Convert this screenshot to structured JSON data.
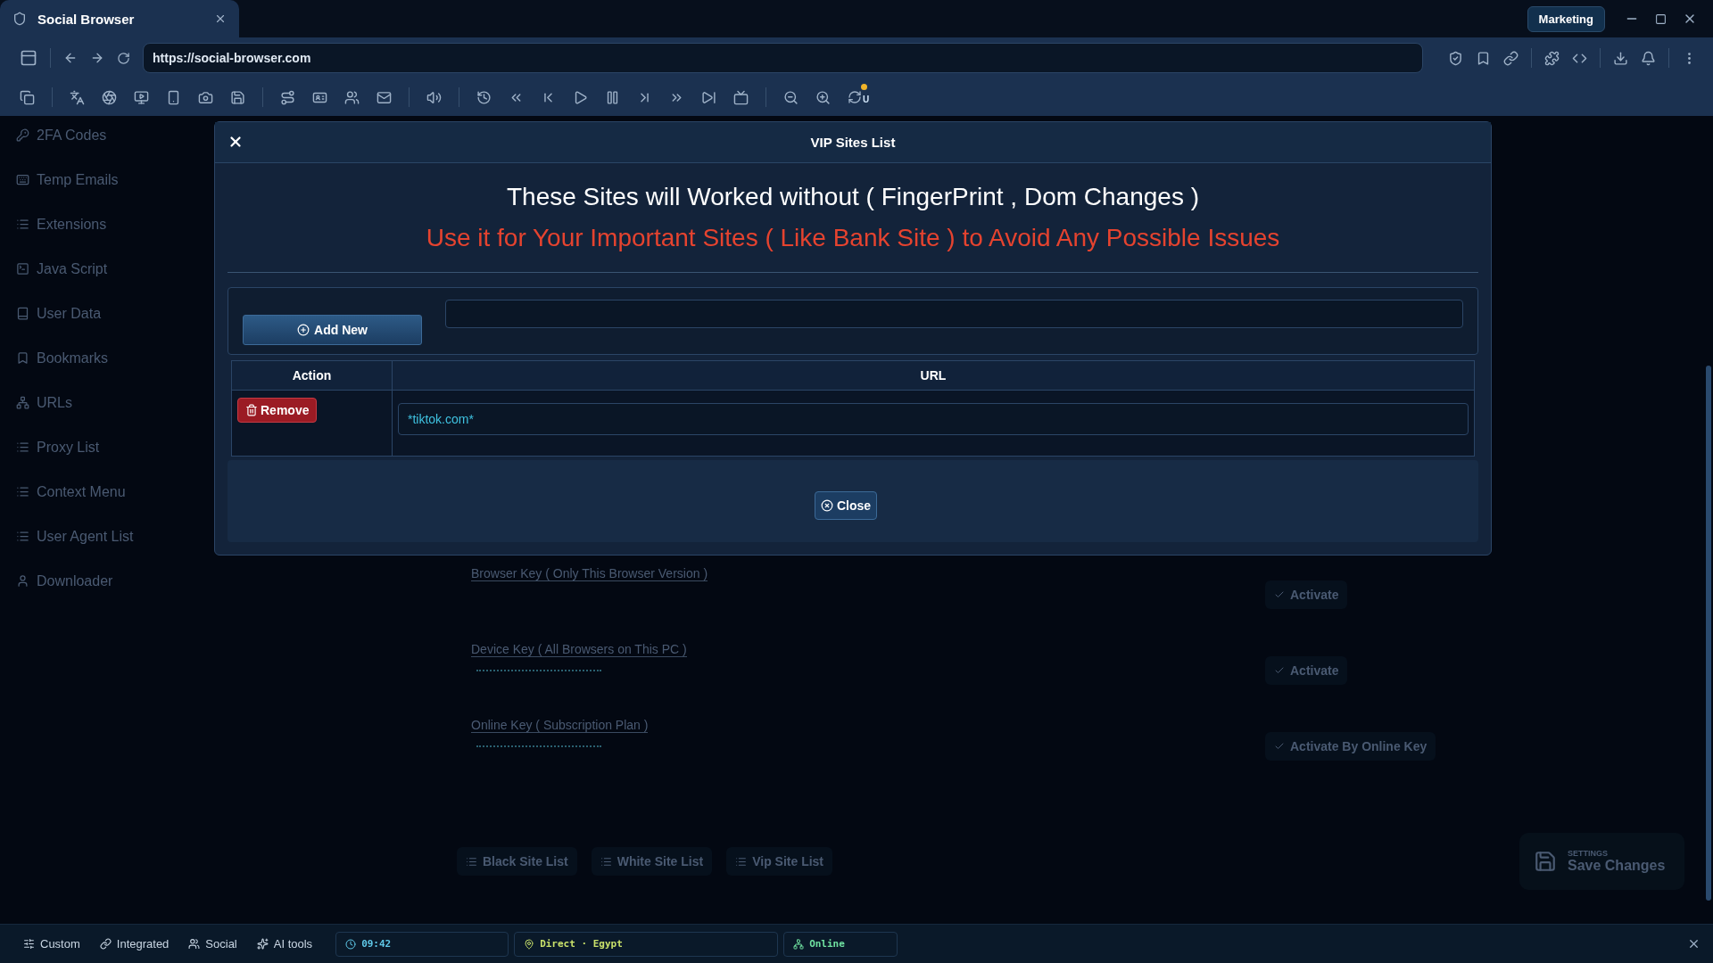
{
  "window": {
    "tab_title": "Social Browser",
    "profile": "Marketing"
  },
  "address_bar": {
    "url": "https://social-browser.com"
  },
  "toolbar": {
    "badge_letter": "U"
  },
  "sidebar": {
    "items": [
      "2FA Codes",
      "Temp Emails",
      "Extensions",
      "Java Script",
      "User Data",
      "Bookmarks",
      "URLs",
      "Proxy List",
      "Context Menu",
      "User Agent List",
      "Downloader"
    ]
  },
  "page": {
    "keys": [
      {
        "label": "Browser Key ( Only This Browser Version )",
        "masked": false,
        "button": "Activate"
      },
      {
        "label": "Device Key ( All Browsers on This PC )",
        "masked": true,
        "button": "Activate"
      },
      {
        "label": "Online Key ( Subscription Plan )",
        "masked": true,
        "button": "Activate By Online Key"
      }
    ],
    "site_lists": [
      "Black Site List",
      "White Site List",
      "Vip Site List"
    ],
    "save": {
      "caption": "SETTINGS",
      "label": "Save Changes"
    }
  },
  "dialog": {
    "title": "VIP Sites List",
    "heading": "These Sites will Worked without ( FingerPrint , Dom Changes )",
    "warning": "Use it for Your Important Sites ( Like Bank Site ) to Avoid Any Possible Issues",
    "add_button": "Add New",
    "columns": [
      "Action",
      "URL"
    ],
    "rows": [
      {
        "action": "Remove",
        "url": "*tiktok.com*"
      }
    ],
    "close_button": "Close"
  },
  "status_bar": {
    "modes": [
      "Custom",
      "Integrated",
      "Social",
      "AI tools"
    ],
    "time": "09:42",
    "route": "Direct · Egypt",
    "connection": "Online"
  }
}
